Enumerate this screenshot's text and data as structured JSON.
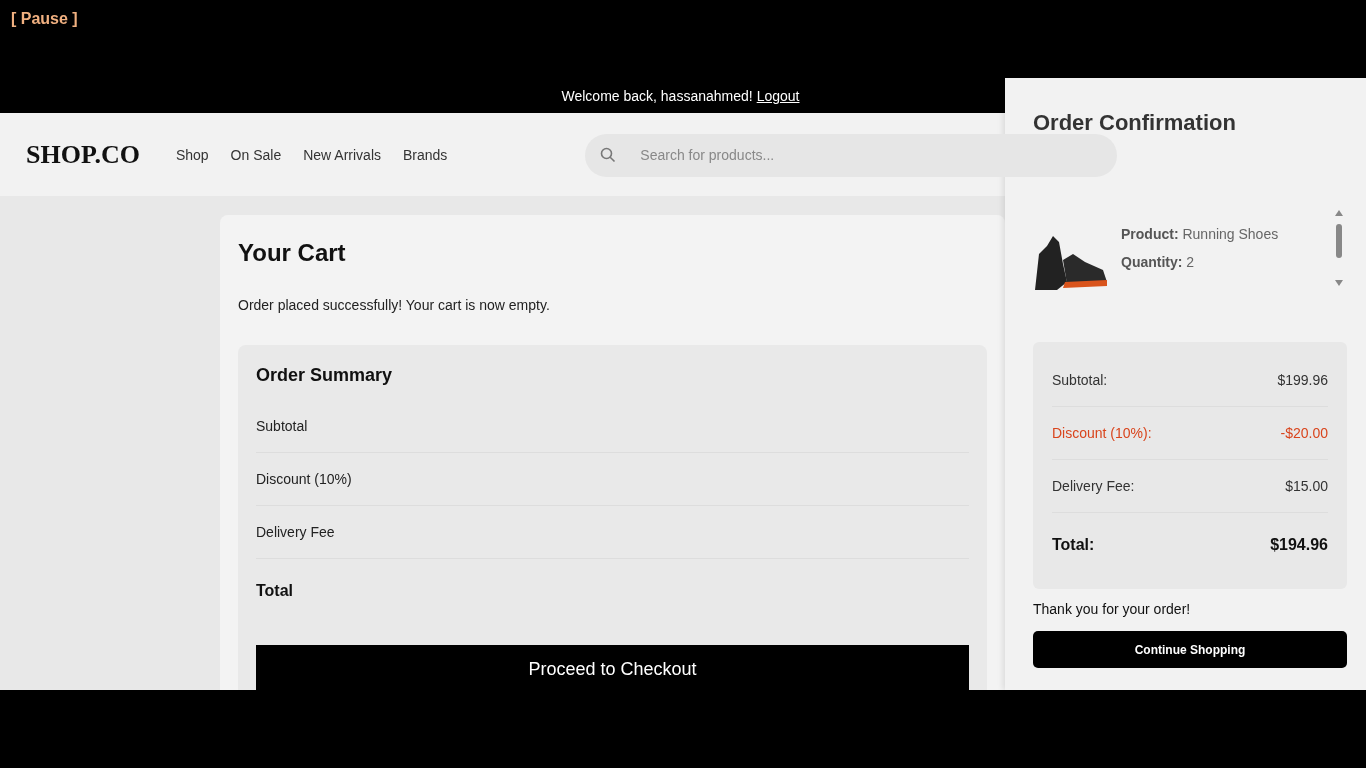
{
  "player": {
    "status": "[ Pause ]"
  },
  "welcome": {
    "text": "Welcome back, hassanahmed!",
    "link": "Logout"
  },
  "header": {
    "logo": "SHOP.CO",
    "nav": [
      {
        "label": "Shop"
      },
      {
        "label": "On Sale"
      },
      {
        "label": "New Arrivals"
      },
      {
        "label": "Brands"
      }
    ],
    "search": {
      "placeholder": "Search for products..."
    }
  },
  "cart": {
    "title": "Your Cart",
    "message": "Order placed successfully! Your cart is now empty.",
    "summary": {
      "title": "Order Summary",
      "rows": [
        {
          "kind": "line",
          "label": "Subtotal"
        },
        {
          "kind": "line",
          "label": "Discount (10%)"
        },
        {
          "kind": "line",
          "label": "Delivery Fee"
        },
        {
          "kind": "total",
          "label": "Total"
        }
      ]
    },
    "checkout_button": "Proceed to Checkout"
  },
  "confirmation": {
    "title": "Order Confirmation",
    "item": {
      "fields": [
        {
          "label": "Product:",
          "value": "Running Shoes"
        },
        {
          "label": "Quantity:",
          "value": "2"
        }
      ]
    },
    "summary": [
      {
        "kind": "line",
        "label": "Subtotal:",
        "value": "$199.96"
      },
      {
        "kind": "discount",
        "label": "Discount (10%):",
        "value": "-$20.00"
      },
      {
        "kind": "line",
        "label": "Delivery Fee:",
        "value": "$15.00"
      },
      {
        "kind": "total",
        "label": "Total:",
        "value": "$194.96"
      }
    ],
    "thanks": "Thank you for your order!",
    "button": "Continue Shopping"
  }
}
